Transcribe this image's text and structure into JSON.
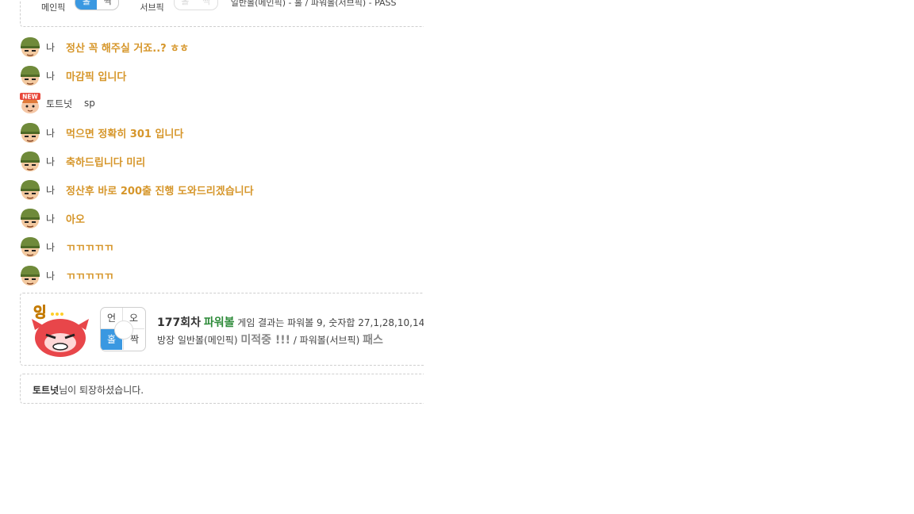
{
  "top_pick": {
    "main_pick_label": "메인픽",
    "main_pick_on": "홀",
    "main_pick_off": "짝",
    "sub_pick_label": "서브픽",
    "sub_pick_on": "홀",
    "sub_pick_off": "짝",
    "result_text": "일반볼(메인픽) - 홀 / 파워볼(서브픽) - PASS"
  },
  "messages": [
    {
      "nick": "나",
      "text": "정산 꼭 해주실 거죠..? ㅎㅎ"
    },
    {
      "nick": "나",
      "text": "마감픽 입니다"
    },
    {
      "nick": "토트넛",
      "text": "sp"
    },
    {
      "nick": "나",
      "text": "먹으면 정확히 301 입니다"
    },
    {
      "nick": "나",
      "text": "축하드립니다 미리"
    },
    {
      "nick": "나",
      "text": "정산후 바로 200출 진행 도와드리겠습니다"
    },
    {
      "nick": "나",
      "text": "아오"
    },
    {
      "nick": "나",
      "text": "ㄲㄲㄲㄲㄲ"
    },
    {
      "nick": "나",
      "text": "ㄲㄲㄲㄲㄲ"
    }
  ],
  "result": {
    "pick_cells": [
      "언",
      "오",
      "홀",
      "짝"
    ],
    "round": "177회차",
    "game": "파워볼",
    "line1_text": "게임 결과는 파워볼 9, 숫자합 27,1,28,10,14",
    "line2_prefix": "방장 일반볼(메인픽)",
    "line2_miss": "미적중 !!!",
    "line2_mid": "/ 파워볼(서브픽)",
    "line2_pass": "패스"
  },
  "exit_notice": {
    "name": "토트넛",
    "text": "님이 퇴장하셨습니다."
  },
  "colors": {
    "my_message": "#d6962a",
    "pick_on": "#3a98e1",
    "game_name": "#2e8b3a"
  },
  "icons": {
    "my_avatar": "soldier-avatar-icon",
    "other_avatar": "new-user-avatar-icon",
    "result_mascot": "angry-mascot-icon"
  }
}
